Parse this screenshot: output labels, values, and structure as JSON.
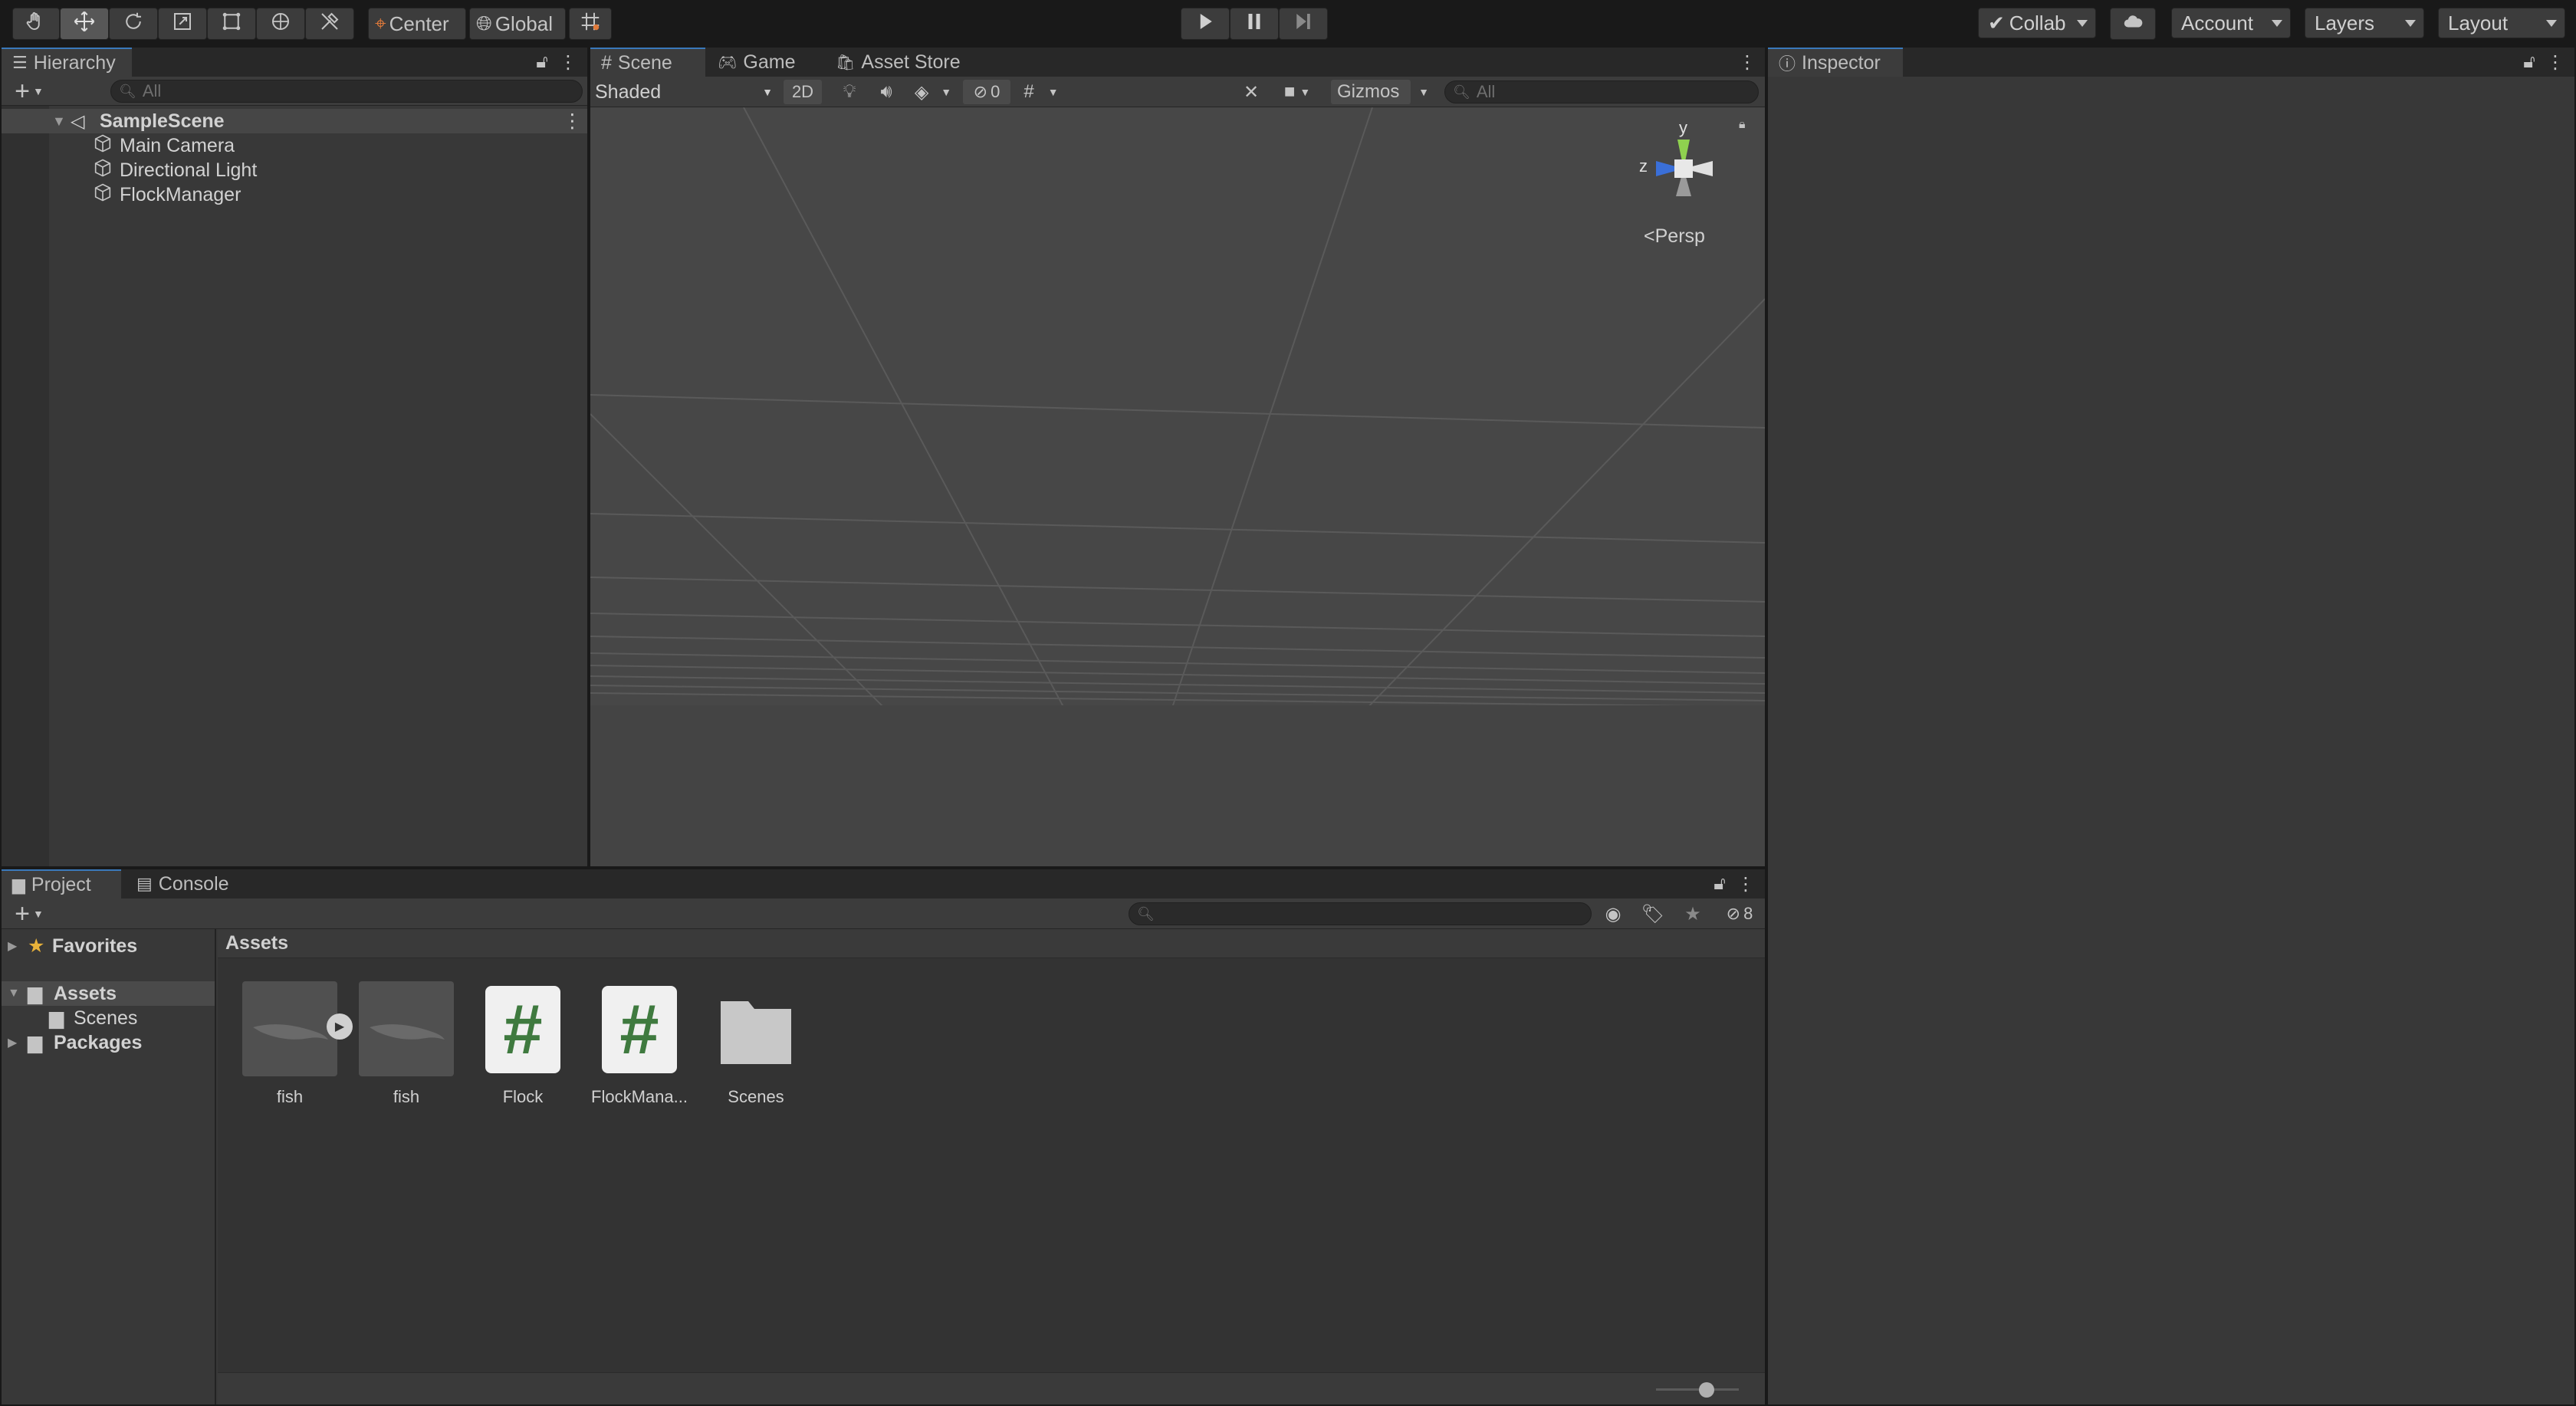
{
  "toolbar": {
    "tools": [
      "hand-icon",
      "move-icon",
      "rotate-icon",
      "scale-icon",
      "rect-icon",
      "transform-icon",
      "custom-tool-icon"
    ],
    "pivot_label": "Center",
    "space_label": "Global",
    "play_controls": [
      "play-icon",
      "pause-icon",
      "step-icon"
    ],
    "collab_label": "Collab",
    "account_label": "Account",
    "layers_label": "Layers",
    "layout_label": "Layout"
  },
  "hierarchy": {
    "tab_label": "Hierarchy",
    "search_placeholder": "All",
    "scene_name": "SampleScene",
    "items": [
      {
        "label": "Main Camera"
      },
      {
        "label": "Directional Light"
      },
      {
        "label": "FlockManager"
      }
    ]
  },
  "scene": {
    "tabs": [
      {
        "label": "Scene"
      },
      {
        "label": "Game"
      },
      {
        "label": "Asset Store"
      }
    ],
    "shading_mode": "Shaded",
    "mode_2d_label": "2D",
    "hidden_count": "0",
    "gizmos_label": "Gizmos",
    "search_placeholder": "All",
    "axis_y": "y",
    "axis_z": "z",
    "projection_label": "Persp"
  },
  "inspector": {
    "tab_label": "Inspector"
  },
  "project": {
    "tabs": [
      {
        "label": "Project"
      },
      {
        "label": "Console"
      }
    ],
    "hidden_packages_count": "8",
    "tree": {
      "favorites": "Favorites",
      "assets": "Assets",
      "scenes": "Scenes",
      "packages": "Packages"
    },
    "breadcrumb": "Assets",
    "assets": [
      {
        "label": "fish",
        "icon": "fish-model-icon"
      },
      {
        "label": "fish",
        "icon": "fish-model-icon"
      },
      {
        "label": "Flock",
        "icon": "csharp-script-icon"
      },
      {
        "label": "FlockMana...",
        "icon": "csharp-script-icon"
      },
      {
        "label": "Scenes",
        "icon": "folder-icon"
      }
    ],
    "script_glyph": "#"
  },
  "colors": {
    "accent": "#3a79bb",
    "script_green": "#3f7a3f",
    "axis_y": "#8fd14f",
    "axis_x": "#e0e0e0",
    "axis_z": "#3a6fd8"
  }
}
